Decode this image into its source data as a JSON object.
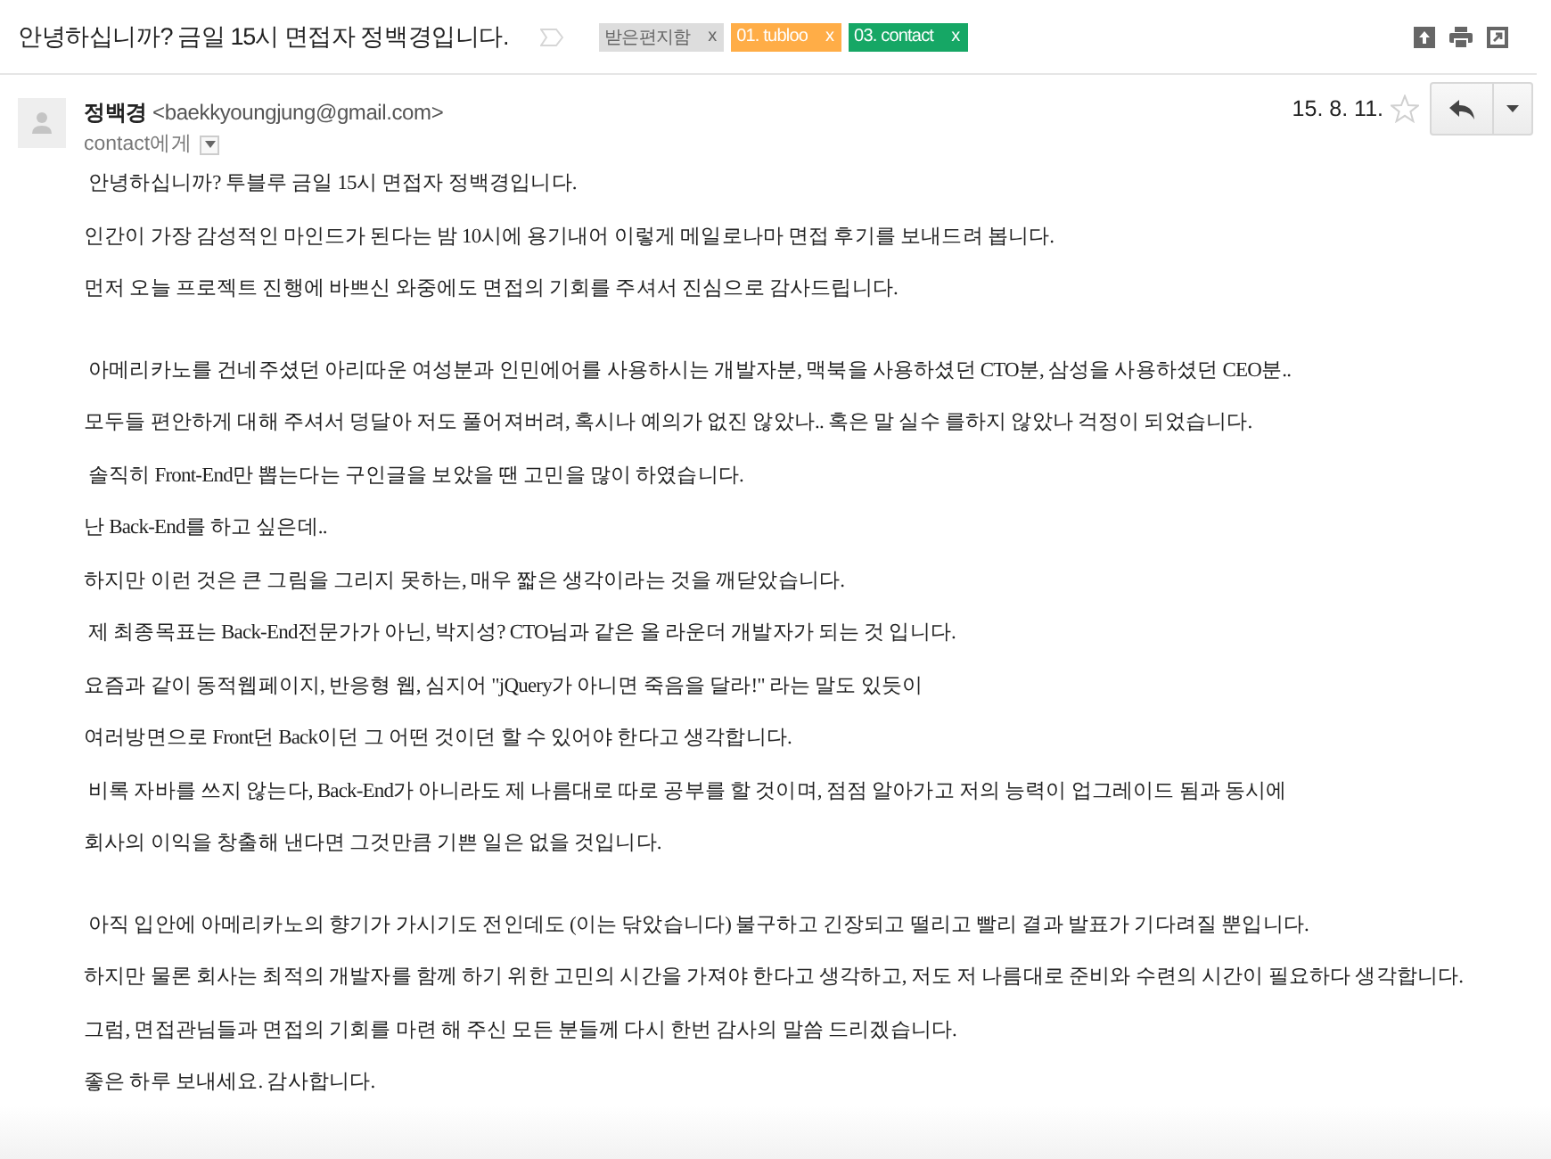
{
  "subject": "안녕하십니까? 금일 15시 면접자 정백경입니다.",
  "important": false,
  "labels": [
    {
      "name": "받은편지함",
      "color": "#dddddd",
      "remove": "x"
    },
    {
      "name": "01. tubloo",
      "color": "#ffad47",
      "remove": "x"
    },
    {
      "name": "03. contact",
      "color": "#16a765",
      "remove": "x"
    }
  ],
  "message": {
    "sender_name": "정백경",
    "sender_email": "<baekkyoungjung@gmail.com>",
    "recipient": "contact에게",
    "date": "15. 8. 11.",
    "starred": false,
    "paragraphs": [
      [
        " 안녕하십니까? 투블루 금일 15시 면접자 정백경입니다.",
        "인간이 가장 감성적인 마인드가 된다는 밤 10시에 용기내어 이렇게 메일로나마 면접 후기를 보내드려 봅니다.",
        "먼저 오늘 프로젝트 진행에 바쁘신 와중에도 면접의 기회를 주셔서 진심으로 감사드립니다."
      ],
      [
        " 아메리카노를 건네주셨던 아리따운 여성분과 인민에어를 사용하시는 개발자분, 맥북을 사용하셨던 CTO분, 삼성을 사용하셨던 CEO분..",
        "모두들 편안하게 대해 주셔서 덩달아 저도 풀어져버려, 혹시나 예의가 없진 않았나.. 혹은 말 실수 를하지 않았나 걱정이 되었습니다.",
        " 솔직히 Front-End만 뽑는다는 구인글을 보았을 땐 고민을 많이 하였습니다.",
        "난 Back-End를 하고 싶은데..",
        "하지만 이런 것은 큰 그림을 그리지 못하는, 매우 짧은 생각이라는 것을 깨닫았습니다.",
        " 제 최종목표는 Back-End전문가가 아닌, 박지성? CTO님과 같은 올 라운더 개발자가 되는 것 입니다.",
        "요즘과 같이 동적웹페이지, 반응형 웹, 심지어 \"jQuery가 아니면 죽음을 달라!\" 라는 말도 있듯이",
        "여러방면으로 Front던 Back이던 그 어떤 것이던 할 수 있어야 한다고 생각합니다.",
        " 비록 자바를 쓰지 않는다, Back-End가 아니라도 제 나름대로 따로 공부를 할 것이며, 점점 알아가고 저의 능력이 업그레이드 됨과 동시에",
        "회사의 이익을 창출해 낸다면 그것만큼 기쁜 일은 없을 것입니다."
      ],
      [
        " 아직 입안에 아메리카노의 향기가 가시기도 전인데도 (이는 닦았습니다) 불구하고 긴장되고 떨리고 빨리 결과 발표가 기다려질 뿐입니다.",
        "하지만 물론 회사는 최적의 개발자를 함께 하기 위한 고민의 시간을 가져야 한다고 생각하고, 저도 저 나름대로 준비와 수련의 시간이 필요하다 생각합니다.",
        "그럼, 면접관님들과 면접의 기회를 마련 해 주신 모든 분들께 다시 한번 감사의 말씀 드리겠습니다.",
        "좋은 하루 보내세요. 감사합니다."
      ]
    ]
  }
}
